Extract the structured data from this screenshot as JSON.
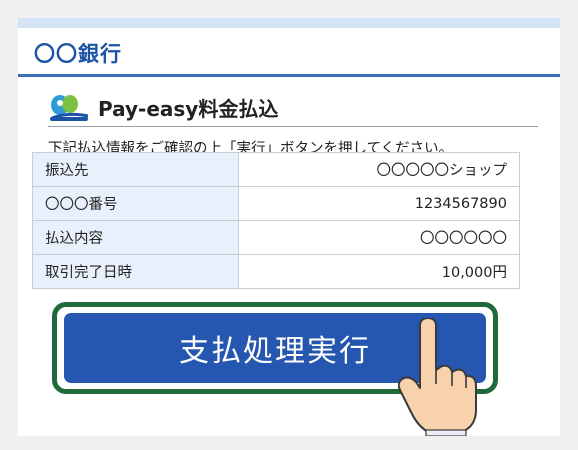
{
  "bank": {
    "name": "〇〇銀行"
  },
  "section": {
    "title": "Pay-easy料金払込",
    "logo_icon": "pay-easy-logo"
  },
  "instruction": "下記払込情報をご確認の上「実行」ボタンを押してください。",
  "payment_info": {
    "rows": [
      {
        "label": "振込先",
        "value": "〇〇〇〇〇ショップ"
      },
      {
        "label": "〇〇〇番号",
        "value": "1234567890"
      },
      {
        "label": "払込内容",
        "value": "〇〇〇〇〇〇"
      },
      {
        "label": "取引完了日時",
        "value": "10,000円"
      }
    ]
  },
  "submit": {
    "label": "支払処理実行",
    "pointer_icon": "pointing-hand-icon"
  },
  "colors": {
    "brand_blue": "#1c54a5",
    "button_blue": "#2557b0",
    "highlight_green": "#1e6a3a",
    "label_bg": "#e8f0fb"
  }
}
